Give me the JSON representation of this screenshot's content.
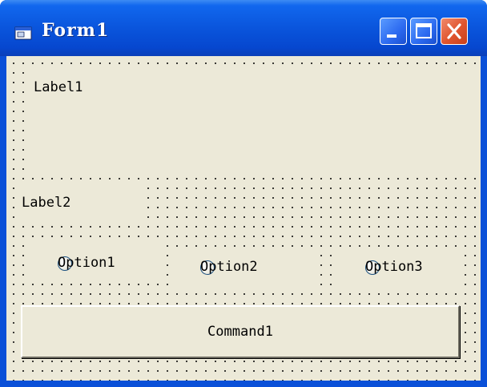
{
  "window": {
    "title": "Form1",
    "title_icon": "form-icon",
    "buttons": [
      "minimize-icon",
      "maximize-icon",
      "close-icon"
    ]
  },
  "labels": {
    "label1": "Label1",
    "label2": "Label2"
  },
  "options": [
    {
      "label": "Option1",
      "selected": false
    },
    {
      "label": "Option2",
      "selected": false
    },
    {
      "label": "Option3",
      "selected": false
    }
  ],
  "command": {
    "label": "Command1"
  },
  "colors": {
    "titlebar": "#0a55dc",
    "client": "#ece9d8",
    "close_button": "#e0542e"
  }
}
